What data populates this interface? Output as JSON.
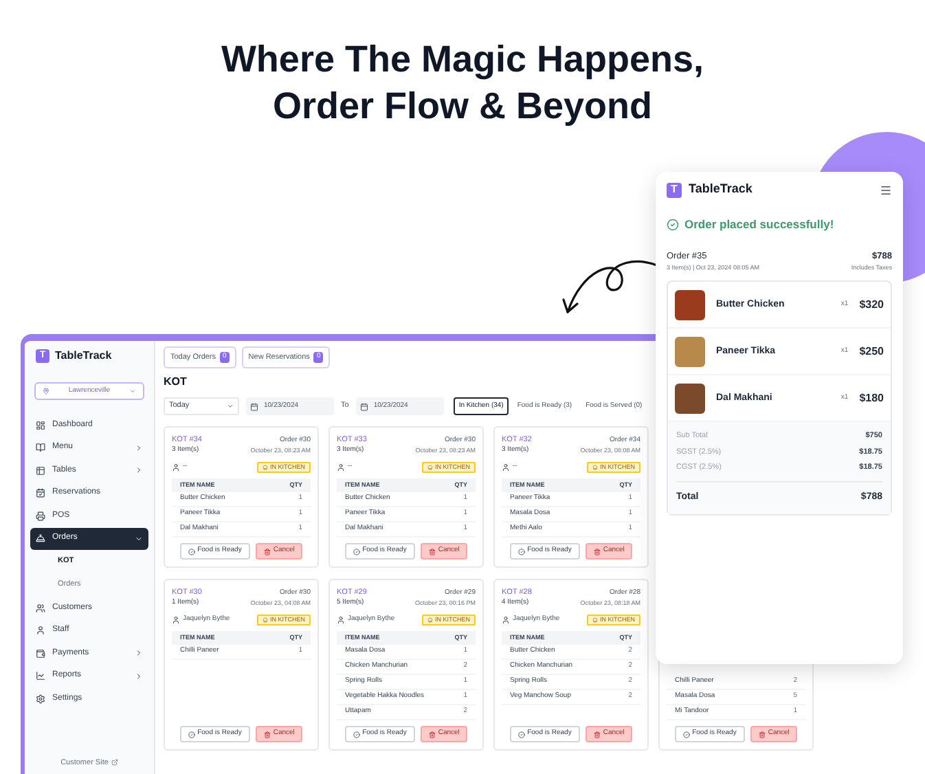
{
  "headline": [
    "Where The Magic Happens,",
    "Order Flow & Beyond"
  ],
  "app": {
    "logo_letter": "T",
    "brand": "TableTrack",
    "location": "Lawrenceville",
    "top_buttons": [
      {
        "label": "Today Orders",
        "count": "0"
      },
      {
        "label": "New Reservations",
        "count": "0"
      }
    ],
    "sidebar": [
      {
        "label": "Dashboard",
        "selected": false,
        "has_submenu": false
      },
      {
        "label": "Menu",
        "selected": false,
        "has_submenu": true
      },
      {
        "label": "Tables",
        "selected": false,
        "has_submenu": true
      },
      {
        "label": "Reservations",
        "selected": false,
        "has_submenu": false
      },
      {
        "label": "POS",
        "selected": false,
        "has_submenu": false
      },
      {
        "label": "Orders",
        "selected": true,
        "has_submenu": true,
        "expanded": true,
        "children": [
          {
            "label": "KOT",
            "selected": true
          },
          {
            "label": "Orders",
            "selected": false
          }
        ]
      },
      {
        "label": "Customers",
        "selected": false,
        "has_submenu": false
      },
      {
        "label": "Staff",
        "selected": false,
        "has_submenu": false
      },
      {
        "label": "Payments",
        "selected": false,
        "has_submenu": true
      },
      {
        "label": "Reports",
        "selected": false,
        "has_submenu": true
      },
      {
        "label": "Settings",
        "selected": false,
        "has_submenu": false
      }
    ],
    "footer_link": "Customer Site",
    "page_title": "KOT",
    "filters": {
      "range": "Today",
      "from": "10/23/2024",
      "to_label": "To",
      "to": "10/23/2024"
    },
    "status_tabs": [
      {
        "label": "In Kitchen (34)",
        "selected": true
      },
      {
        "label": "Food is Ready (3)",
        "selected": false
      },
      {
        "label": "Food is Served (0)",
        "selected": false
      }
    ],
    "cards": [
      {
        "kind": "full",
        "kot": "KOT #34",
        "order": "Order #30",
        "items_count": "3 Item(s)",
        "time": "October 23, 08:23 AM",
        "waiter": "--",
        "status": "IN KITCHEN",
        "columns": [
          "ITEM NAME",
          "QTY"
        ],
        "items": [
          {
            "name": "Butter Chicken",
            "qty": "1"
          },
          {
            "name": "Paneer Tikka",
            "qty": "1"
          },
          {
            "name": "Dal Makhani",
            "qty": "1"
          }
        ],
        "actions": [
          "Food is Ready",
          "Cancel"
        ]
      },
      {
        "kind": "full",
        "kot": "KOT #33",
        "order": "Order #30",
        "items_count": "3 Item(s)",
        "time": "October 23, 08:23 AM",
        "waiter": "--",
        "status": "IN KITCHEN",
        "columns": [
          "ITEM NAME",
          "QTY"
        ],
        "items": [
          {
            "name": "Butter Chicken",
            "qty": "1"
          },
          {
            "name": "Paneer Tikka",
            "qty": "1"
          },
          {
            "name": "Dal Makhani",
            "qty": "1"
          }
        ],
        "actions": [
          "Food is Ready",
          "Cancel"
        ]
      },
      {
        "kind": "full",
        "kot": "KOT #32",
        "order": "Order #34",
        "items_count": "3 Item(s)",
        "time": "October 23, 08:08 AM",
        "waiter": "--",
        "status": "IN KITCHEN",
        "columns": [
          "ITEM NAME",
          "QTY"
        ],
        "items": [
          {
            "name": "Paneer Tikka",
            "qty": "1"
          },
          {
            "name": "Masala Dosa",
            "qty": "1"
          },
          {
            "name": "Methi Aalo",
            "qty": "1"
          }
        ],
        "actions": [
          "Food is Ready",
          "Cancel"
        ]
      },
      {
        "kind": "hidden"
      },
      {
        "kind": "full",
        "kot": "KOT #30",
        "order": "Order #30",
        "items_count": "1 Item(s)",
        "time": "October 23, 04:08 AM",
        "waiter": "Jaquelyn Bythe",
        "status": "IN KITCHEN",
        "columns": [
          "ITEM NAME",
          "QTY"
        ],
        "items": [
          {
            "name": "Chilli Paneer",
            "qty": "1"
          }
        ],
        "actions": [
          "Food is Ready",
          "Cancel"
        ]
      },
      {
        "kind": "full",
        "kot": "KOT #29",
        "order": "Order #29",
        "items_count": "5 Item(s)",
        "time": "October 23, 00:16 PM",
        "waiter": "Jaquelyn Bythe",
        "status": "IN KITCHEN",
        "columns": [
          "ITEM NAME",
          "QTY"
        ],
        "items": [
          {
            "name": "Masala Dosa",
            "qty": "1"
          },
          {
            "name": "Chicken Manchurian",
            "qty": "2"
          },
          {
            "name": "Spring Rolls",
            "qty": "1"
          },
          {
            "name": "Vegetable Hakka Noodles",
            "qty": "1"
          },
          {
            "name": "Uttapam",
            "qty": "2"
          }
        ],
        "actions": [
          "Food is Ready",
          "Cancel"
        ]
      },
      {
        "kind": "full",
        "kot": "KOT #28",
        "order": "Order #28",
        "items_count": "4 Item(s)",
        "time": "October 23, 08:18 AM",
        "waiter": "Jaquelyn Bythe",
        "status": "IN KITCHEN",
        "columns": [
          "ITEM NAME",
          "QTY"
        ],
        "items": [
          {
            "name": "Butter Chicken",
            "qty": "2"
          },
          {
            "name": "Chicken Manchurian",
            "qty": "2"
          },
          {
            "name": "Spring Rolls",
            "qty": "2"
          },
          {
            "name": "Veg Manchow Soup",
            "qty": "2"
          }
        ],
        "actions": [
          "Food is Ready",
          "Cancel"
        ]
      },
      {
        "kind": "partial",
        "items": [
          {
            "name": "Chilli Paneer",
            "qty": "2"
          },
          {
            "name": "Masala Dosa",
            "qty": "5"
          },
          {
            "name": "Mi Tandoor",
            "qty": "1"
          }
        ],
        "actions": [
          "Food is Ready",
          "Cancel"
        ]
      }
    ]
  },
  "phone": {
    "logo_letter": "T",
    "brand": "TableTrack",
    "message": "Order placed successfully!",
    "order": "Order #35",
    "amount": "$788",
    "meta": "3 Item(s) | Oct 23, 2024 08:05 AM",
    "tax_note": "Includes Taxes",
    "items": [
      {
        "name": "Butter Chicken",
        "qty": "x1",
        "price": "$320"
      },
      {
        "name": "Paneer Tikka",
        "qty": "x1",
        "price": "$250"
      },
      {
        "name": "Dal Makhani",
        "qty": "x1",
        "price": "$180"
      }
    ],
    "summary": [
      {
        "label": "Sub Total",
        "value": "$750"
      },
      {
        "label": "SGST (2.5%)",
        "value": "$18.75"
      },
      {
        "label": "CGST (2.5%)",
        "value": "$18.75"
      }
    ],
    "total": {
      "label": "Total",
      "value": "$788"
    }
  }
}
